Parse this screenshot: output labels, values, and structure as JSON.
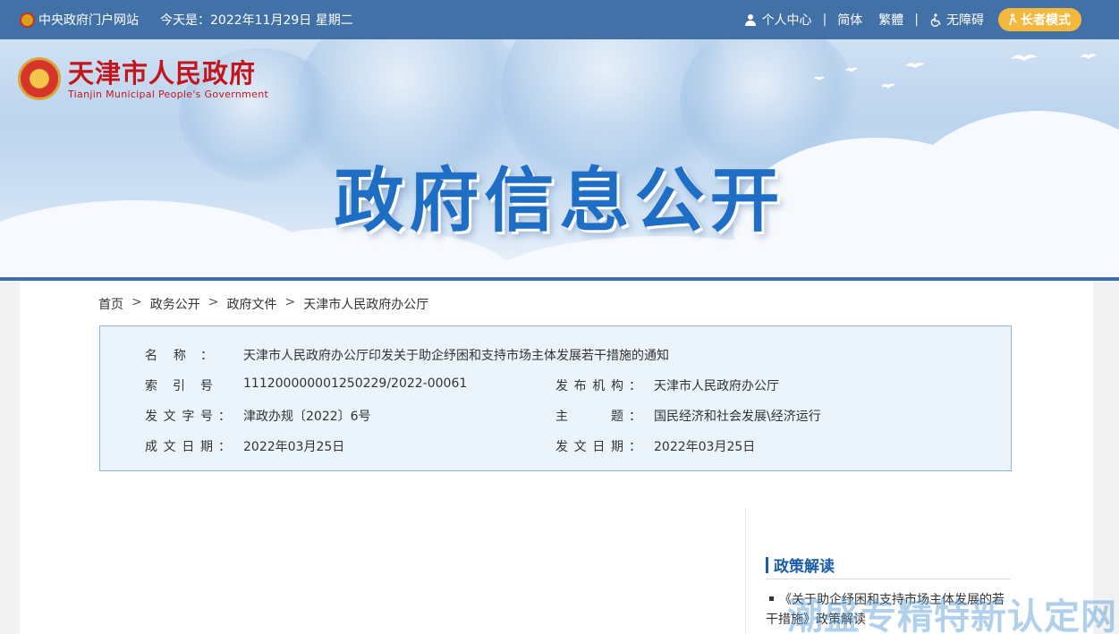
{
  "topbar": {
    "portal_link": "中央政府门户网站",
    "today": "今天是：2022年11月29日 星期二",
    "personal_center": "个人中心",
    "simplified": "简体",
    "traditional": "繁體",
    "accessibility": "无障碍",
    "elder_mode": "长者模式"
  },
  "banner": {
    "site_name_cn": "天津市人民政府",
    "site_name_en": "Tianjin Municipal People's Government",
    "title": "政府信息公开"
  },
  "breadcrumb": {
    "items": [
      "首页",
      "政务公开",
      "政府文件",
      "天津市人民政府办公厅"
    ],
    "separator": ">"
  },
  "info_table": {
    "labels": {
      "name": [
        "名",
        "称"
      ],
      "index": [
        "索",
        "引",
        "号"
      ],
      "publisher": [
        "发",
        "布",
        "机",
        "构"
      ],
      "doc_no": [
        "发",
        "文",
        "字",
        "号"
      ],
      "subject": [
        "主",
        "题"
      ],
      "created": [
        "成",
        "文",
        "日",
        "期"
      ],
      "issued": [
        "发",
        "文",
        "日",
        "期"
      ]
    },
    "colon": "：",
    "values": {
      "name": "天津市人民政府办公厅印发关于助企纾困和支持市场主体发展若干措施的通知",
      "index": "111200000001250229/2022-00061",
      "publisher": "天津市人民政府办公厅",
      "doc_no": "津政办规〔2022〕6号",
      "subject": "国民经济和社会发展\\经济运行",
      "created": "2022年03月25日",
      "issued": "2022年03月25日"
    }
  },
  "sidebar": {
    "title": "政策解读",
    "items": [
      "《关于助企纾困和支持市场主体发展的若干措施》政策解读"
    ]
  },
  "watermark": "潮盛专精特新认定网",
  "colors": {
    "topbar": "#4271a8",
    "logo_red": "#c3161c",
    "title_blue": "#1d6ec4",
    "elder_button": "#f4b93c",
    "info_bg": "#ecf4fb",
    "info_border": "#8cb5dc"
  }
}
